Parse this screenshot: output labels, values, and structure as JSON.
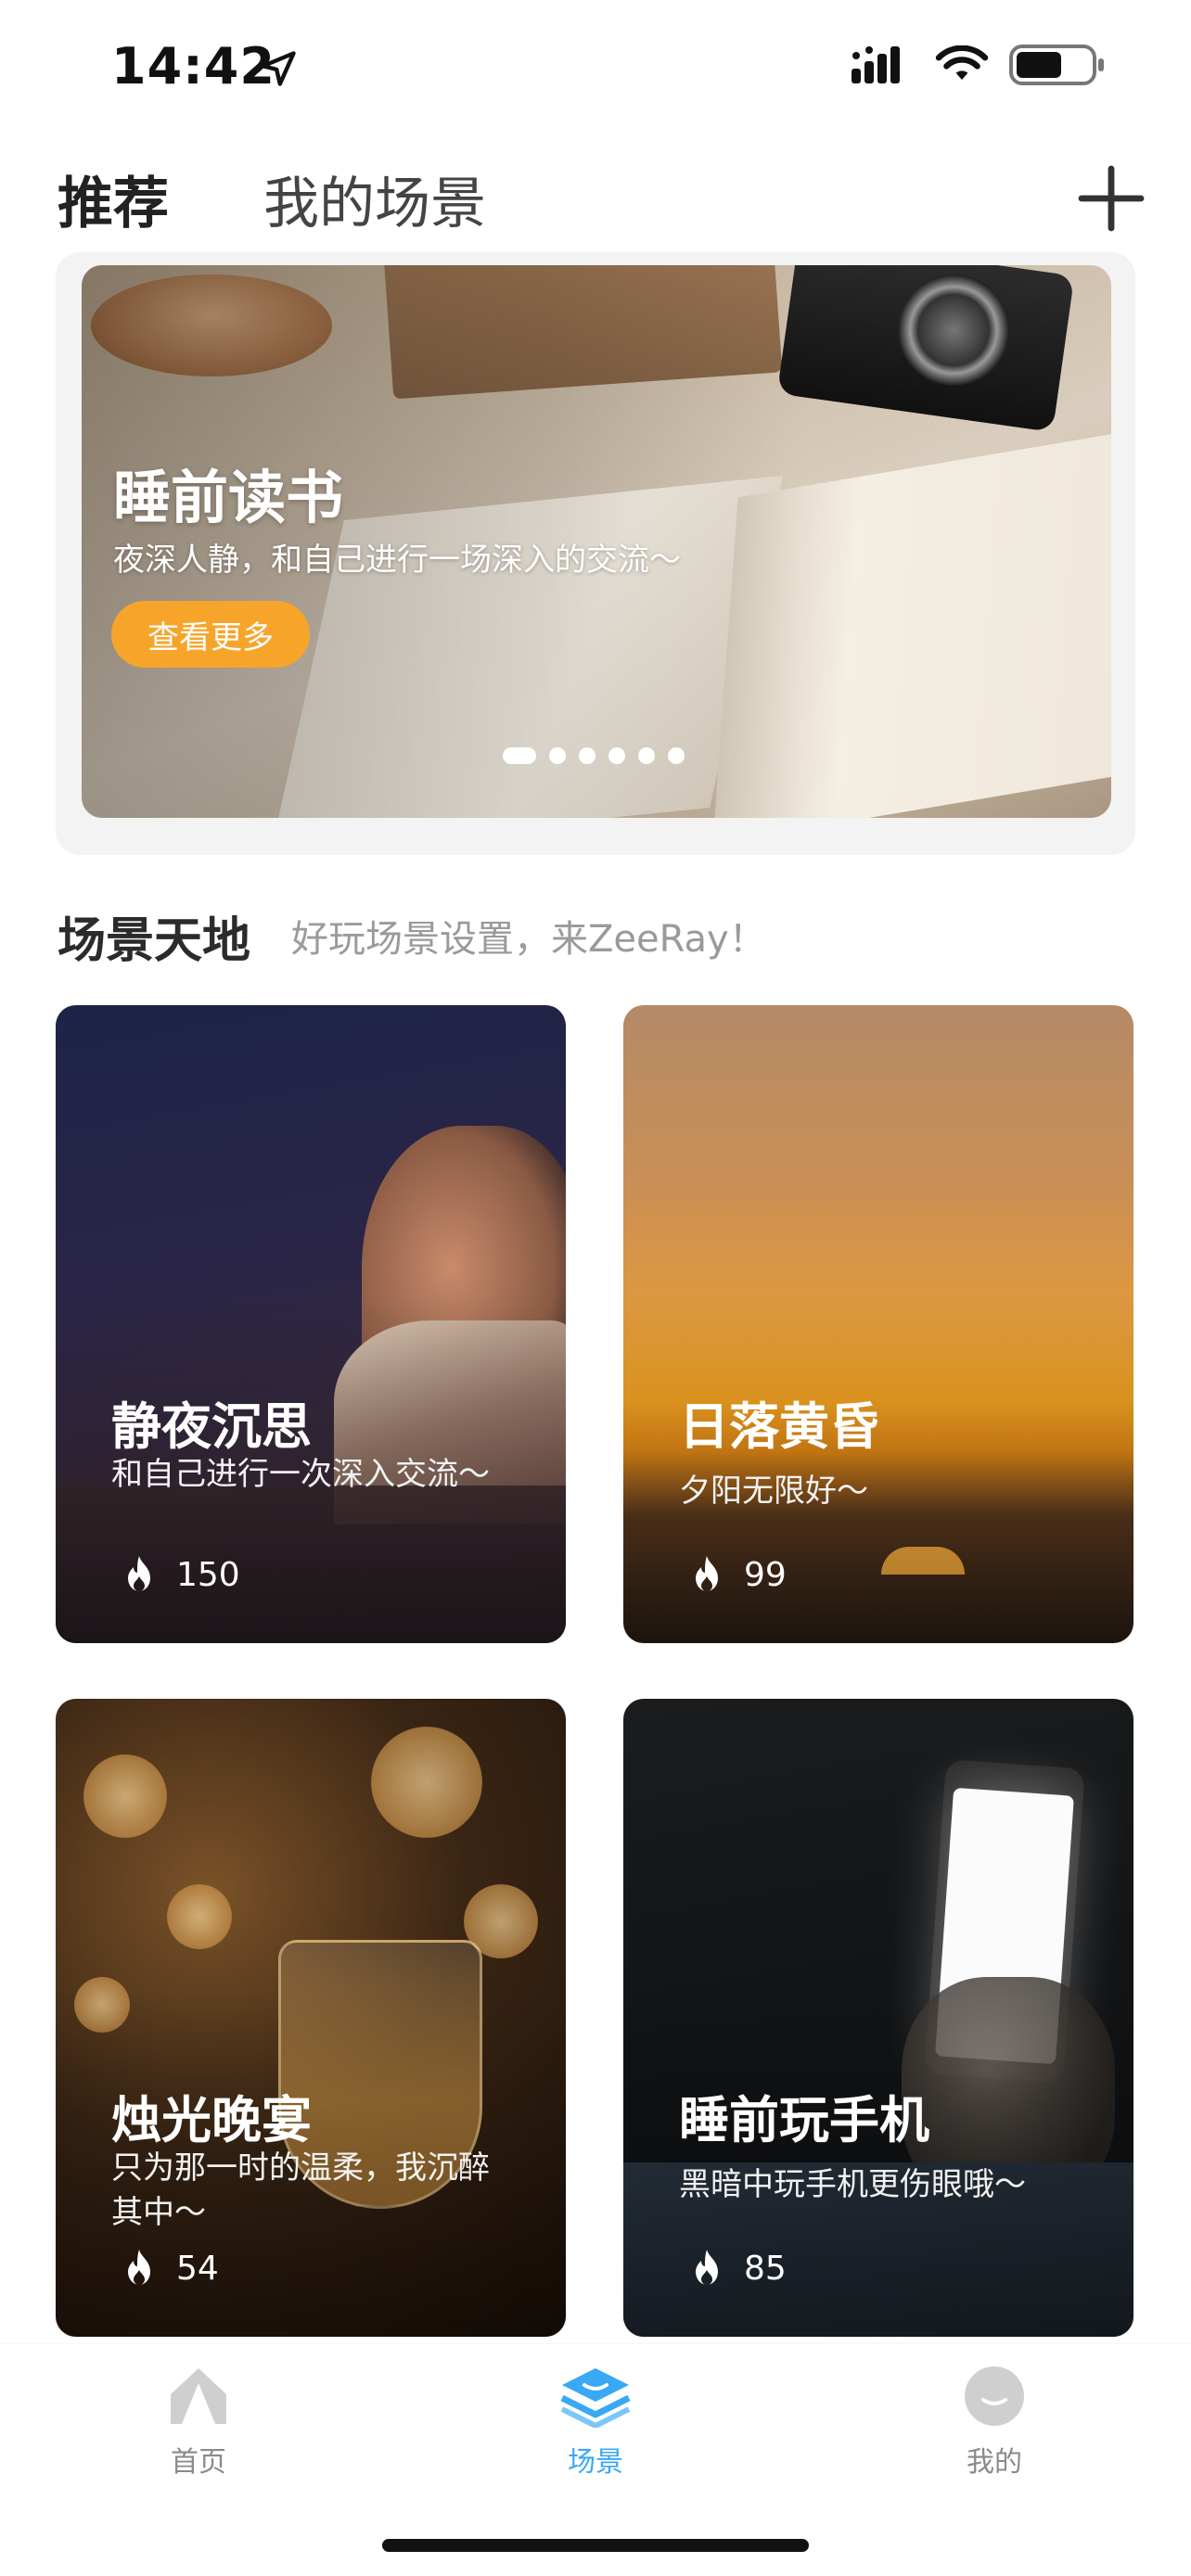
{
  "status_bar": {
    "time": "14:42"
  },
  "top_tabs": {
    "recommend": "推荐",
    "my_scenes": "我的场景"
  },
  "banner": {
    "title": "睡前读书",
    "subtitle": "夜深人静，和自己进行一场深入的交流～",
    "button": "查看更多",
    "page_count": 6,
    "active_page": 1
  },
  "section": {
    "title": "场景天地",
    "subtitle": "好玩场景设置，来ZeeRay！"
  },
  "cards": [
    {
      "title": "静夜沉思",
      "desc": "和自己进行一次深入交流～",
      "count": "150"
    },
    {
      "title": "日落黄昏",
      "desc": "夕阳无限好～",
      "count": "99"
    },
    {
      "title": "烛光晚宴",
      "desc": "只为那一时的温柔，我沉醉其中～",
      "count": "54"
    },
    {
      "title": "睡前玩手机",
      "desc": "黑暗中玩手机更伤眼哦～",
      "count": "85"
    }
  ],
  "tab_bar": {
    "home": "首页",
    "scenes": "场景",
    "mine": "我的",
    "active": "场景"
  },
  "colors": {
    "accent": "#39a8f5",
    "button": "#f7a52a",
    "inactive_tab": "#8a8a8a"
  },
  "icons": [
    "location-arrow-icon",
    "signal-icon",
    "wifi-icon",
    "battery-icon",
    "plus-icon",
    "flame-icon",
    "home-icon",
    "scenes-icon",
    "profile-icon"
  ]
}
